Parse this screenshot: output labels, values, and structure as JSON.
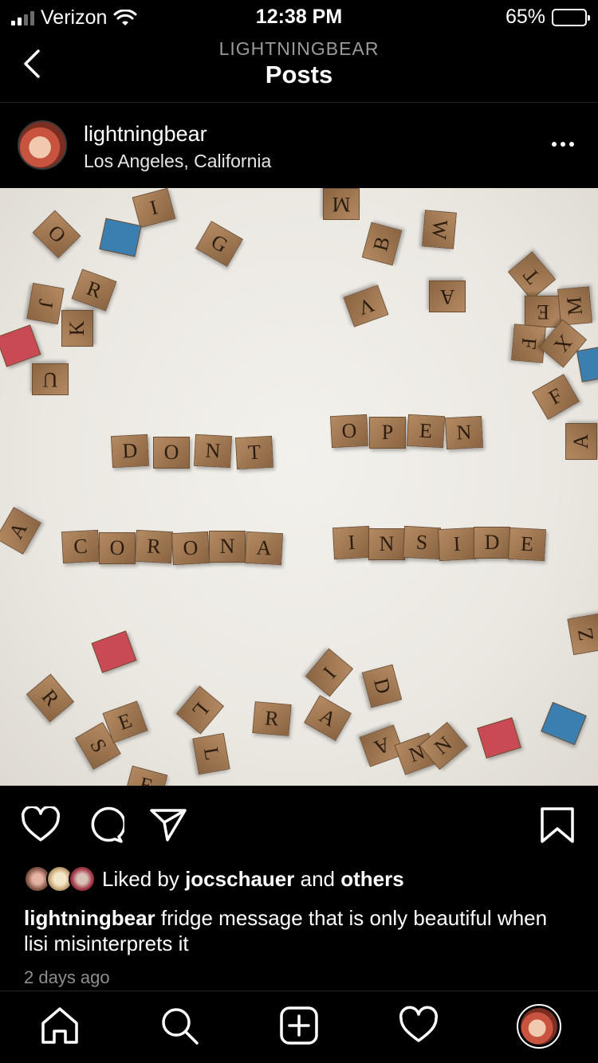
{
  "status_bar": {
    "carrier": "Verizon",
    "time": "12:38 PM",
    "battery": "65%",
    "battery_level": 0.65
  },
  "nav": {
    "subtitle": "LIGHTNINGBEAR",
    "title": "Posts"
  },
  "post": {
    "username": "lightningbear",
    "location": "Los Angeles, California",
    "likes_prefix": "Liked by",
    "liked_by_user": "jocschauer",
    "likes_and": "and",
    "likes_others": "others",
    "caption_user": "lightningbear",
    "caption_text": "fridge message that is only beautiful when lisi misinterprets it",
    "time_ago": "2 days ago"
  },
  "photo": {
    "message_rows": [
      [
        "D",
        "O",
        "N",
        "T"
      ],
      [
        "O",
        "P",
        "E",
        "N"
      ],
      [
        "C",
        "O",
        "R",
        "O",
        "N",
        "A"
      ],
      [
        "I",
        "N",
        "S",
        "I",
        "D",
        "E"
      ]
    ],
    "scattered_letters": [
      "O",
      "I",
      "G",
      "R",
      "J",
      "K",
      "U",
      "M",
      "B",
      "W",
      "V",
      "A",
      "T",
      "E",
      "M",
      "F",
      "X",
      "F",
      "A",
      "A",
      "Z",
      "I",
      "D",
      "A",
      "S",
      "E",
      "L",
      "R",
      "A",
      "N",
      "N",
      "L",
      "E",
      "R"
    ]
  },
  "icons": {
    "back": "chevron-left-icon",
    "more": "more-horizontal-icon",
    "like": "heart-icon",
    "comment": "comment-icon",
    "share": "paper-plane-icon",
    "save": "bookmark-icon",
    "home": "home-icon",
    "search": "search-icon",
    "create": "plus-square-icon",
    "activity": "heart-icon",
    "profile": "profile-avatar"
  }
}
